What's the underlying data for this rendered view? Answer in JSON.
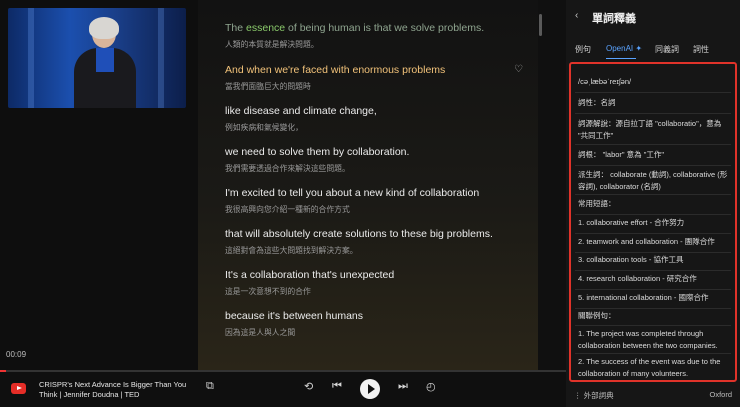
{
  "video": {
    "time": "00:09",
    "progress_fraction": 0.01
  },
  "transcript": {
    "lines": [
      {
        "pre": "The ",
        "highlight": "essence",
        "post": " of being human is that we solve problems.",
        "zh": "人類的本質就是解決問題。"
      },
      {
        "en": "And when we're faced with enormous problems",
        "zh": "當我們面臨巨大的問題時"
      },
      {
        "en": "like disease and climate change,",
        "zh": "例如疾病和氣候變化，"
      },
      {
        "en": "we need to solve them by collaboration.",
        "zh": "我們需要透過合作來解決這些問題。"
      },
      {
        "en": "I'm excited to tell you about a new kind of collaboration",
        "zh": "我很高興向您介紹一種新的合作方式"
      },
      {
        "en": "that will absolutely create solutions to these big problems.",
        "zh": "這絕對會為這些大問題找到解決方案。"
      },
      {
        "en": "It's a collaboration that's unexpected",
        "zh": "這是一次意想不到的合作"
      },
      {
        "en": "because it's between humans",
        "zh": "因為這是人與人之間"
      }
    ]
  },
  "dictionary": {
    "title": "單詞釋義",
    "tabs": [
      "例句",
      "OpenAI ✦",
      "同義詞",
      "詞性"
    ],
    "active_tab": 1,
    "entries": [
      "/cəˌlæbəˈreɪʃən/",
      "詞性：名詞",
      "詞源解說：源自拉丁語 \"collaboratio\"，意為 \"共同工作\"",
      "詞根： \"labor\" 意為 \"工作\"",
      "派生詞： collaborate (動詞), collaborative (形容詞), collaborator (名詞)",
      "常用短語：",
      "1. collaborative effort - 合作努力",
      "2. teamwork and collaboration - 團隊合作",
      "3. collaboration tools - 協作工具",
      "4. research collaboration - 研究合作",
      "5. international collaboration - 國際合作",
      "關聯例句：",
      "1. The project was completed through collaboration between the two companies.",
      "2. The success of the event was due to the collaboration of many volunteers."
    ],
    "footer_left": "外部詞典",
    "footer_right": "Oxford"
  },
  "player": {
    "title": "CRISPR's Next Advance Is Bigger Than You Think | Jennifer Doudna | TED"
  },
  "colors": {
    "accent_blue": "#5aa3ff",
    "active_line": "#f2c27a",
    "highlight_word": "#8bcb6b",
    "border_red": "#e0332a"
  }
}
